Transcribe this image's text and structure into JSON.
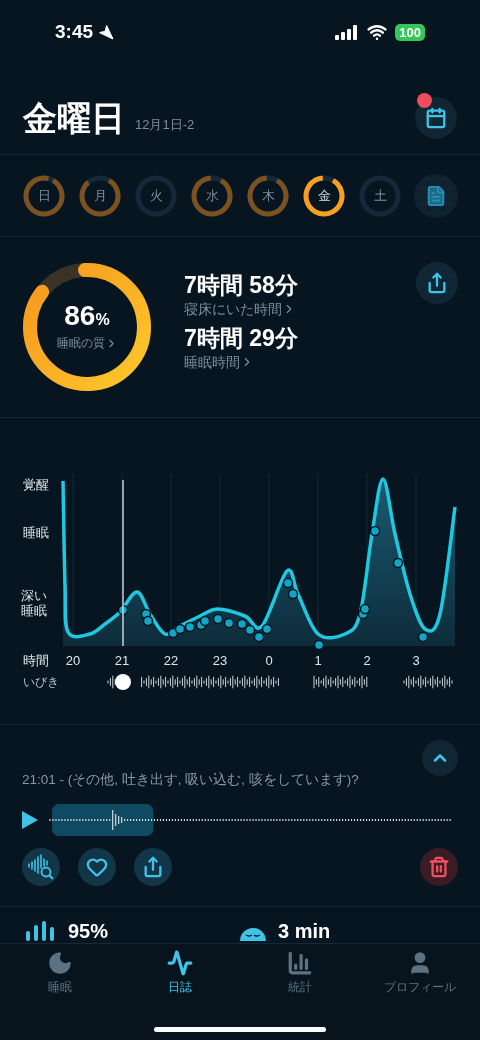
{
  "status_bar": {
    "time": "3:45",
    "battery": "100"
  },
  "header": {
    "title": "金曜日",
    "date_range": "12月1日-2",
    "calendar_badge": true
  },
  "days": [
    {
      "label": "日",
      "level": 0.95,
      "selected": false
    },
    {
      "label": "月",
      "level": 0.8,
      "selected": false
    },
    {
      "label": "火",
      "level": 0,
      "selected": false
    },
    {
      "label": "水",
      "level": 0.9,
      "selected": false
    },
    {
      "label": "木",
      "level": 0.9,
      "selected": false
    },
    {
      "label": "金",
      "level": 0.9,
      "selected": true
    },
    {
      "label": "土",
      "level": 0,
      "selected": false
    }
  ],
  "quality": {
    "value": "86",
    "unit": "%",
    "label": "睡眠の質",
    "level": 0.86
  },
  "metrics": [
    {
      "value": "7時間 58分",
      "label": "寝床にいた時間"
    },
    {
      "value": "7時間 29分",
      "label": "睡眠時間"
    }
  ],
  "chart": {
    "y_labels": [
      "覚醒",
      "睡眠",
      "深い睡眠"
    ],
    "x_axis_label": "時間",
    "hours": [
      "20",
      "21",
      "22",
      "23",
      "0",
      "1",
      "2",
      "3"
    ],
    "snore_label": "いびき"
  },
  "recording": {
    "expanded": true,
    "title": "21:01 - (その他, 吐き出す, 吸い込む, 咳をしています)?"
  },
  "stats": [
    {
      "kind": "bars",
      "value": "95%"
    },
    {
      "kind": "face",
      "value": "3 min"
    }
  ],
  "tabs": [
    {
      "kind": "moon",
      "label": "睡眠",
      "selected": false
    },
    {
      "kind": "wave",
      "label": "日誌",
      "selected": true
    },
    {
      "kind": "bars",
      "label": "統計",
      "selected": false
    },
    {
      "kind": "person",
      "label": "プロフィール",
      "selected": false
    }
  ]
}
